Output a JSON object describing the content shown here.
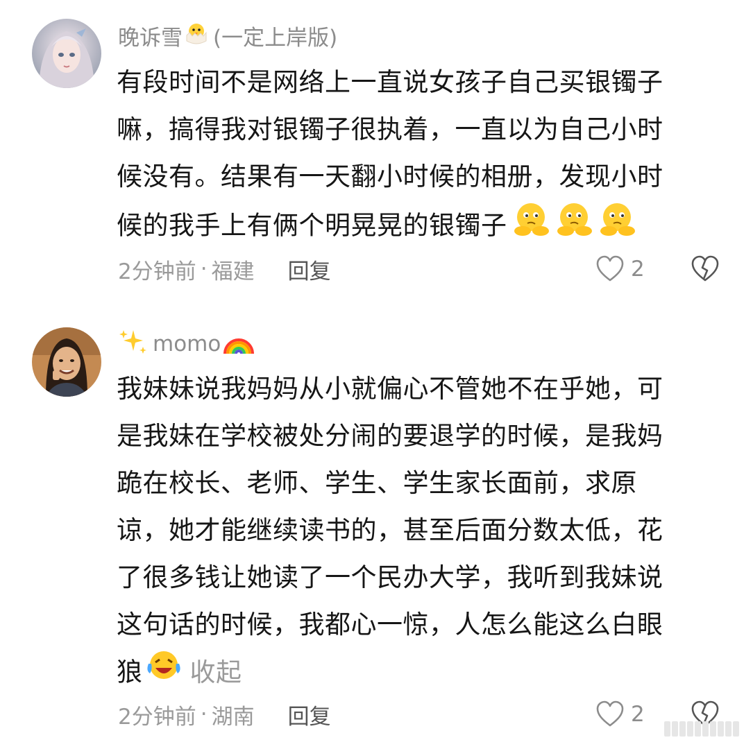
{
  "comments": [
    {
      "username": "晚诉雪",
      "username_emoji": "hatching-chick-emoji",
      "username_suffix": "(一定上岸版)",
      "body_lines": [
        "有段时间不是网络上一直说女孩子自己买银镯子",
        "嘛，搞得我对银镯子很执着，一直以为自己小时",
        "候没有。结果有一天翻小时候的相册，发现小时",
        "候的我手上有俩个明晃晃的银镯子"
      ],
      "trailing_emojis": [
        "thinking-face-emoji",
        "thinking-face-emoji",
        "thinking-face-emoji"
      ],
      "time": "2分钟前",
      "separator": "·",
      "location": "福建",
      "reply_label": "回复",
      "like_count": "2",
      "avatar": "anime-girl-avatar"
    },
    {
      "username": "momo",
      "username_prefix_emoji": "sparkles-emoji",
      "username_emoji": "rainbow-emoji",
      "body_lines": [
        "我妹妹说我妈妈从小就偏心不管她不在乎她，可",
        "是我妹在学校被处分闹的要退学的时候，是我妈",
        "跪在校长、老师、学生、学生家长面前，求原",
        "谅，她才能继续读书的，甚至后面分数太低，花",
        "了很多钱让她读了一个民办大学，我听到我妹说",
        "这句话的时候，我都心一惊，人怎么能这么白眼",
        "狼"
      ],
      "trailing_emojis": [
        "tears-of-joy-emoji"
      ],
      "collapse_label": "收起",
      "time": "2分钟前",
      "separator": "·",
      "location": "湖南",
      "reply_label": "回复",
      "like_count": "2",
      "avatar": "photo-avatar"
    }
  ],
  "colors": {
    "text_primary": "#161616",
    "text_secondary": "#9a9a9a",
    "reply": "#555555",
    "background": "#ffffff"
  }
}
